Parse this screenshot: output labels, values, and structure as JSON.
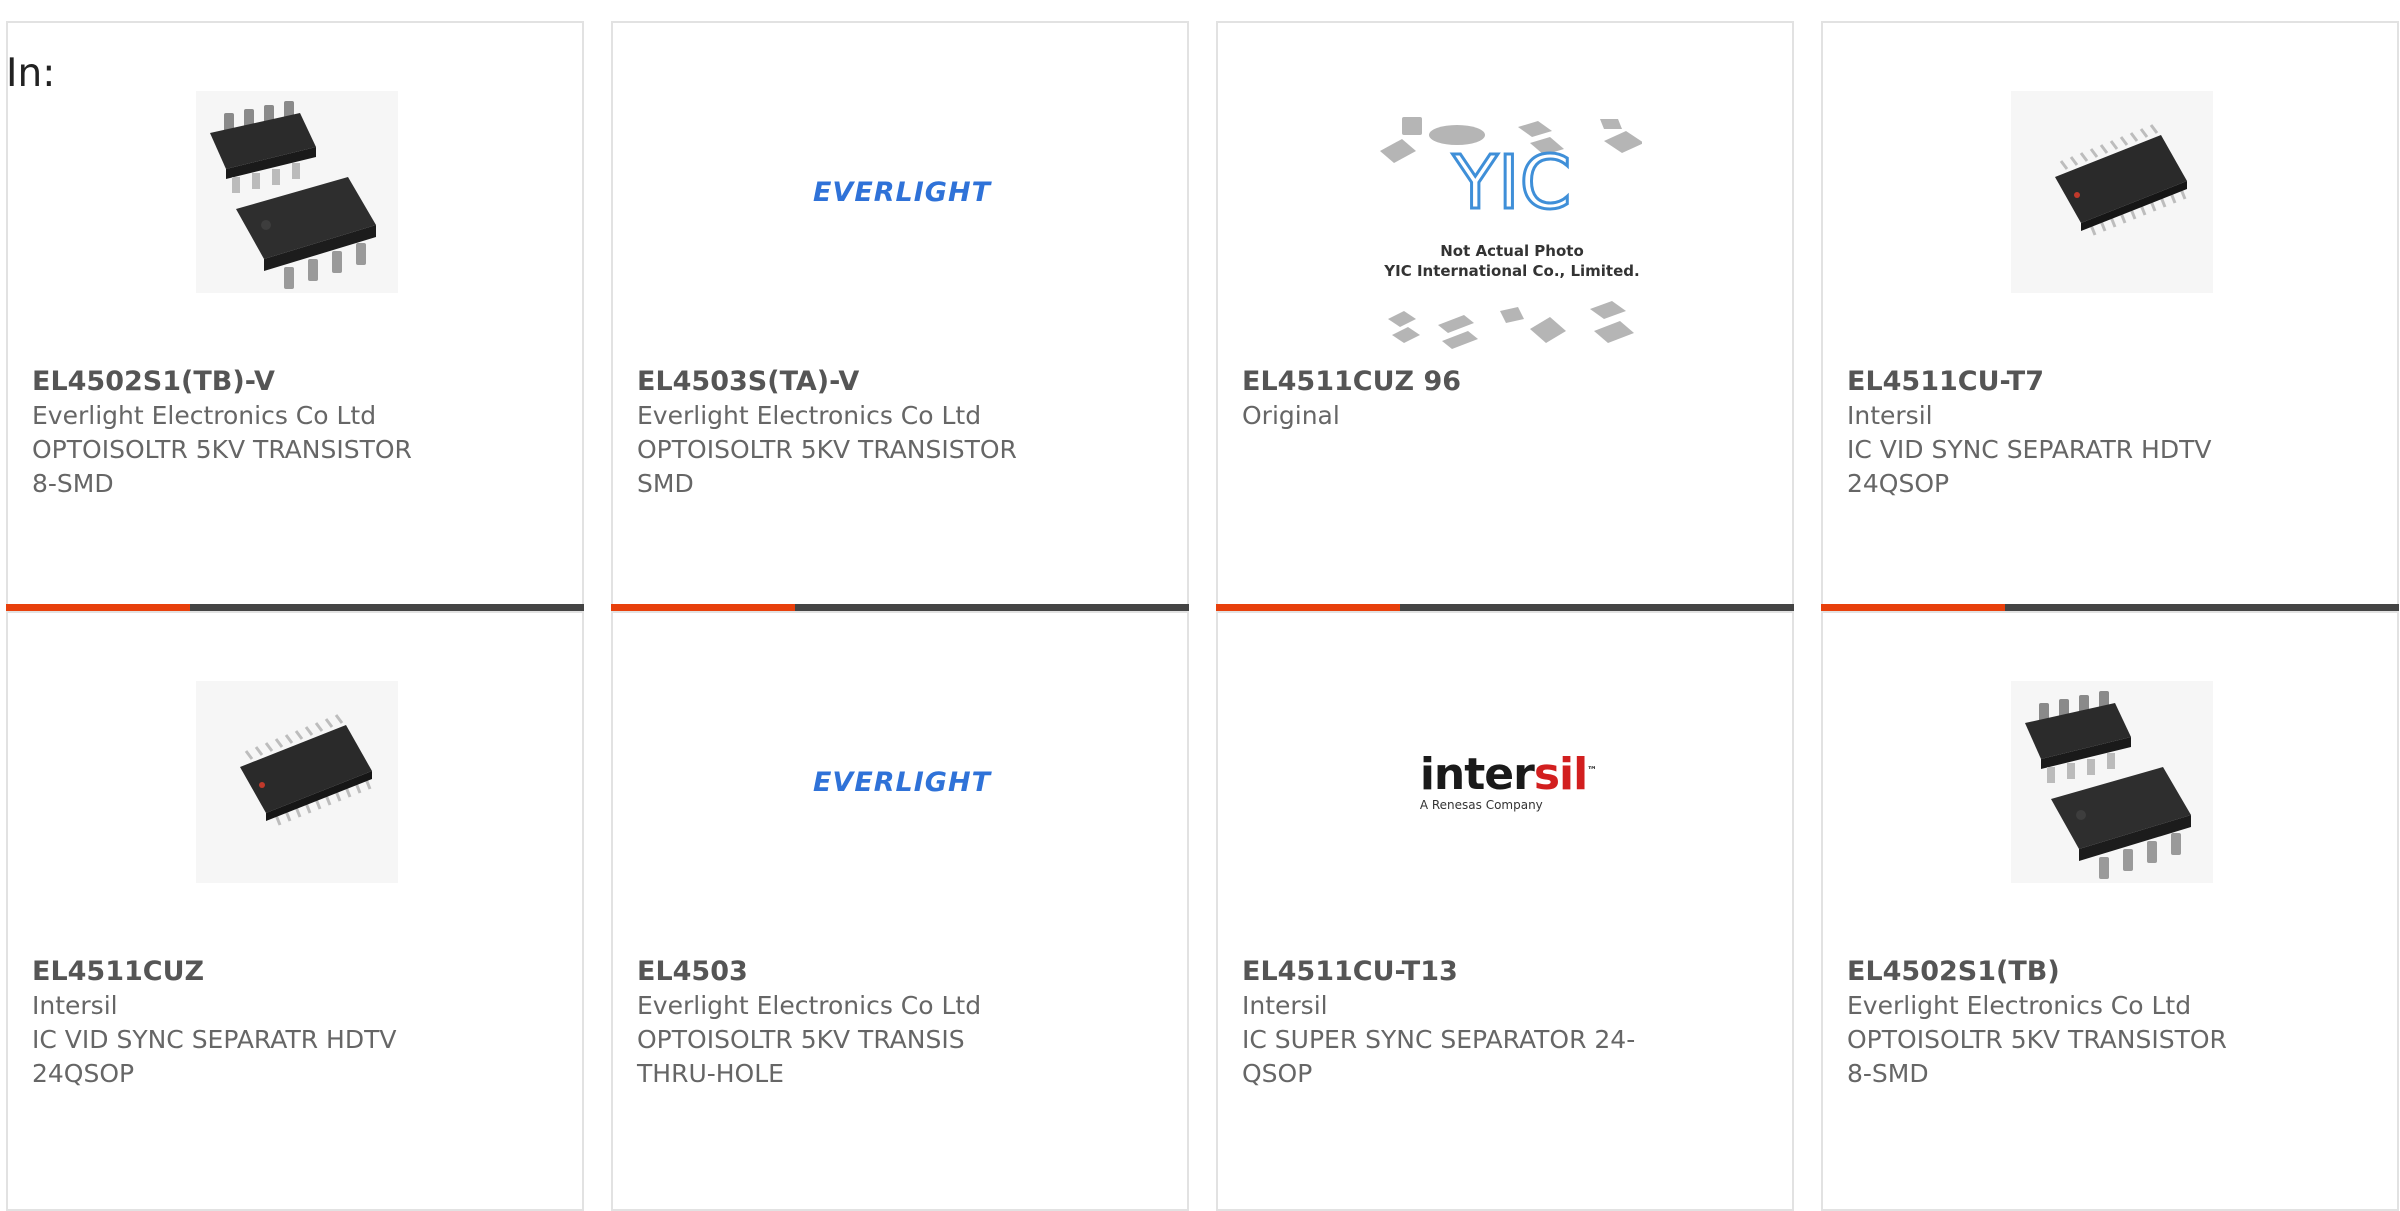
{
  "header": {
    "in_label": "In:"
  },
  "logos": {
    "everlight": "EVERLIGHT",
    "intersil_word_a": "inter",
    "intersil_word_b": "sil",
    "intersil_tm": "™",
    "intersil_sub": "A Renesas Company",
    "yic_line1": "Not Actual Photo",
    "yic_line2": "YIC International Co., Limited."
  },
  "products": [
    {
      "part": "EL4502S1(TB)-V",
      "lines": [
        "Everlight Electronics Co Ltd",
        "OPTOISOLTR 5KV TRANSISTOR",
        "8-SMD"
      ],
      "image": "chip-8smd"
    },
    {
      "part": "EL4503S(TA)-V",
      "lines": [
        "Everlight Electronics Co Ltd",
        "OPTOISOLTR 5KV TRANSISTOR",
        "SMD"
      ],
      "image": "everlight-logo"
    },
    {
      "part": "EL4511CUZ 96",
      "lines": [
        "Original",
        "",
        ""
      ],
      "image": "yic-placeholder"
    },
    {
      "part": "EL4511CU-T7",
      "lines": [
        "Intersil",
        "IC VID SYNC SEPARATR HDTV",
        "24QSOP"
      ],
      "image": "chip-qsop"
    },
    {
      "part": "EL4511CUZ",
      "lines": [
        "Intersil",
        "IC VID SYNC SEPARATR HDTV",
        "24QSOP"
      ],
      "image": "chip-qsop"
    },
    {
      "part": "EL4503",
      "lines": [
        "Everlight Electronics Co Ltd",
        "OPTOISOLTR 5KV TRANSIS",
        "THRU-HOLE"
      ],
      "image": "everlight-logo"
    },
    {
      "part": "EL4511CU-T13",
      "lines": [
        "Intersil",
        "IC SUPER SYNC SEPARATOR 24-",
        "QSOP"
      ],
      "image": "intersil-logo"
    },
    {
      "part": "EL4502S1(TB)",
      "lines": [
        "Everlight Electronics Co Ltd",
        "OPTOISOLTR 5KV TRANSISTOR",
        "8-SMD"
      ],
      "image": "chip-8smd"
    }
  ],
  "colors": {
    "accent": "#e8400c",
    "bar": "#444444",
    "border": "#e2e2e2"
  }
}
